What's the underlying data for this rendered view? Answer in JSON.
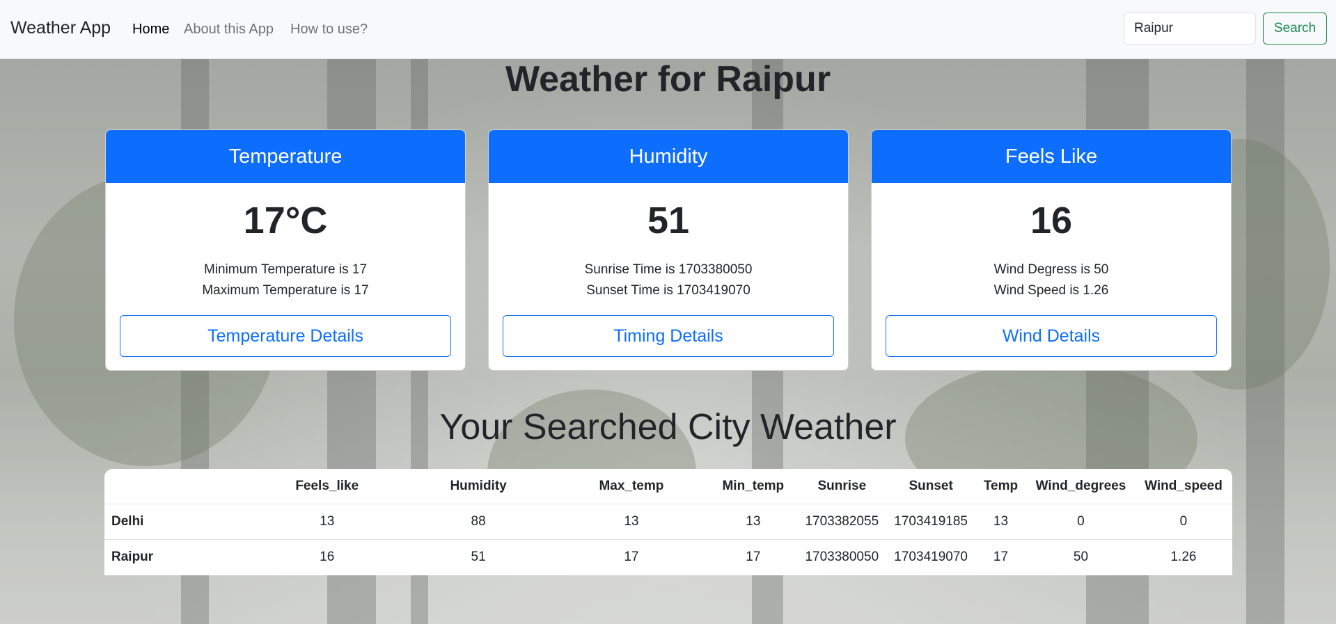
{
  "navbar": {
    "brand": "Weather App",
    "links": [
      "Home",
      "About this App",
      "How to use?"
    ],
    "search_value": "Raipur",
    "search_button": "Search"
  },
  "title": "Weather for Raipur",
  "cards": [
    {
      "header": "Temperature",
      "value": "17°C",
      "line1": "Minimum Temperature is 17",
      "line2": "Maximum Temperature is 17",
      "button": "Temperature Details"
    },
    {
      "header": "Humidity",
      "value": "51",
      "line1": "Sunrise Time is 1703380050",
      "line2": "Sunset Time is 1703419070",
      "button": "Timing Details"
    },
    {
      "header": "Feels Like",
      "value": "16",
      "line1": "Wind Degress is 50",
      "line2": "Wind Speed is 1.26",
      "button": "Wind Details"
    }
  ],
  "section_title": "Your Searched City Weather",
  "table": {
    "headers": [
      "",
      "Feels_like",
      "Humidity",
      "Max_temp",
      "Min_temp",
      "Sunrise",
      "Sunset",
      "Temp",
      "Wind_degrees",
      "Wind_speed"
    ],
    "rows": [
      [
        "Delhi",
        "13",
        "88",
        "13",
        "13",
        "1703382055",
        "1703419185",
        "13",
        "0",
        "0"
      ],
      [
        "Raipur",
        "16",
        "51",
        "17",
        "17",
        "1703380050",
        "1703419070",
        "17",
        "50",
        "1.26"
      ]
    ]
  },
  "colors": {
    "primary": "#0d6efd",
    "success": "#198754",
    "navbar_bg": "#f8f9fa"
  }
}
